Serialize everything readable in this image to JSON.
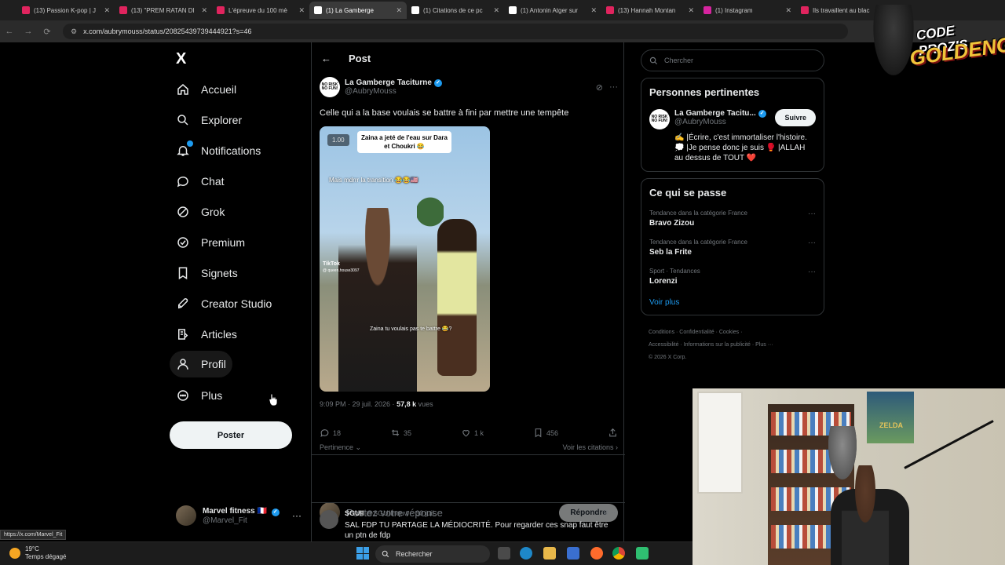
{
  "browser": {
    "tabs": [
      {
        "title": "(13) Passion K-pop | J",
        "fav": "#e0245e",
        "active": false
      },
      {
        "title": "(13) \"PREM RATAN DI",
        "fav": "#e0245e",
        "active": false
      },
      {
        "title": "L'épreuve du 100 mè",
        "fav": "#e0245e",
        "active": false
      },
      {
        "title": "(1) La Gamberge",
        "fav": "#ffffff",
        "active": true
      },
      {
        "title": "(1) Citations de ce pc",
        "fav": "#ffffff",
        "active": false
      },
      {
        "title": "(1) Antonin Atger sur",
        "fav": "#ffffff",
        "active": false
      },
      {
        "title": "(13) Hannah Montan",
        "fav": "#e0245e",
        "active": false
      },
      {
        "title": "(1) Instagram",
        "fav": "#d6249f",
        "active": false
      },
      {
        "title": "Ils travaillent au blac",
        "fav": "#e0245e",
        "active": false
      }
    ],
    "url": "x.com/aubrymouss/status/20825439739444921?s=46",
    "status_url": "https://x.com/Marvel_Fit"
  },
  "nav": {
    "logo": "X",
    "items": [
      {
        "label": "Accueil",
        "icon": "home-icon"
      },
      {
        "label": "Explorer",
        "icon": "search-icon"
      },
      {
        "label": "Notifications",
        "icon": "bell-icon"
      },
      {
        "label": "Chat",
        "icon": "chat-icon"
      },
      {
        "label": "Grok",
        "icon": "grok-icon"
      },
      {
        "label": "Premium",
        "icon": "premium-icon"
      },
      {
        "label": "Signets",
        "icon": "bookmark-icon"
      },
      {
        "label": "Creator Studio",
        "icon": "rocket-icon"
      },
      {
        "label": "Articles",
        "icon": "article-icon"
      },
      {
        "label": "Profil",
        "icon": "profile-icon"
      },
      {
        "label": "Plus",
        "icon": "more-icon"
      }
    ],
    "post_button": "Poster",
    "account": {
      "name": "Marvel fitness 🇫🇷",
      "handle": "@Marvel_Fit"
    }
  },
  "post": {
    "header": "Post",
    "author": {
      "name": "La Gamberge Taciturne",
      "handle": "@AubryMouss",
      "avatar_text": "NO RISK NO FUN!"
    },
    "text": "Celle qui a la base voulais se battre à fini par mettre une tempête",
    "media": {
      "speed": "1.00",
      "caption_top": "Zaina a jeté de l'eau sur Dara et Choukri 😂",
      "caption_mid": "Mais mdrrr la transition 😂😂🇺🇸",
      "caption_bottom": "Zaina tu voulais pas te battre 😂?",
      "tiktok": "TikTok",
      "tiktok_handle": "@ queen.house3097"
    },
    "time": "9:09 PM · 29 juil. 2026 · ",
    "views": "57,8 k",
    "views_label": " vues",
    "stats": {
      "replies": "18",
      "reposts": "35",
      "likes": "1 k",
      "bookmarks": "456"
    },
    "relevance": "Pertinence",
    "quotes": "Voir les citations",
    "reply_placeholder": "Postez votre réponse",
    "reply_button": "Répondre"
  },
  "reply": {
    "name": "SGUII",
    "handle": "@SGUIInquw",
    "date": "· 30 juil.",
    "text": "SAL FDP TU PARTAGE LA MÉDIOCRITÉ. Pour regarder ces snap faut être un ptn de fdp"
  },
  "sidebar": {
    "search_placeholder": "Chercher",
    "relevant": {
      "title": "Personnes pertinentes",
      "name": "La Gamberge Tacitu...",
      "handle": "@AubryMouss",
      "follow": "Suivre",
      "bio": "✍️ |Écrire, c'est immortaliser l'histoire. 💭 |Je pense donc je suis 🥊 |ALLAH au dessus de TOUT ❤️"
    },
    "trending": {
      "title": "Ce qui se passe",
      "items": [
        {
          "category": "Tendance dans la catégorie France",
          "name": "Bravo Zizou"
        },
        {
          "category": "Tendance dans la catégorie France",
          "name": "Seb la Frite"
        },
        {
          "category": "Sport · Tendances",
          "name": "Lorenzi"
        }
      ],
      "see_more": "Voir plus"
    },
    "footer": {
      "line1": "Conditions · Confidentialité · Cookies ·",
      "line2": "Accessibilité · Informations sur la publicité · Plus ···",
      "line3": "© 2026 X Corp."
    }
  },
  "overlay": {
    "logo_line1": "CODE PROZIS",
    "logo_line2": "GOLDENG",
    "poster_text": "ZELDA"
  },
  "taskbar": {
    "temp": "19°C",
    "weather": "Temps dégagé",
    "search": "Rechercher"
  }
}
